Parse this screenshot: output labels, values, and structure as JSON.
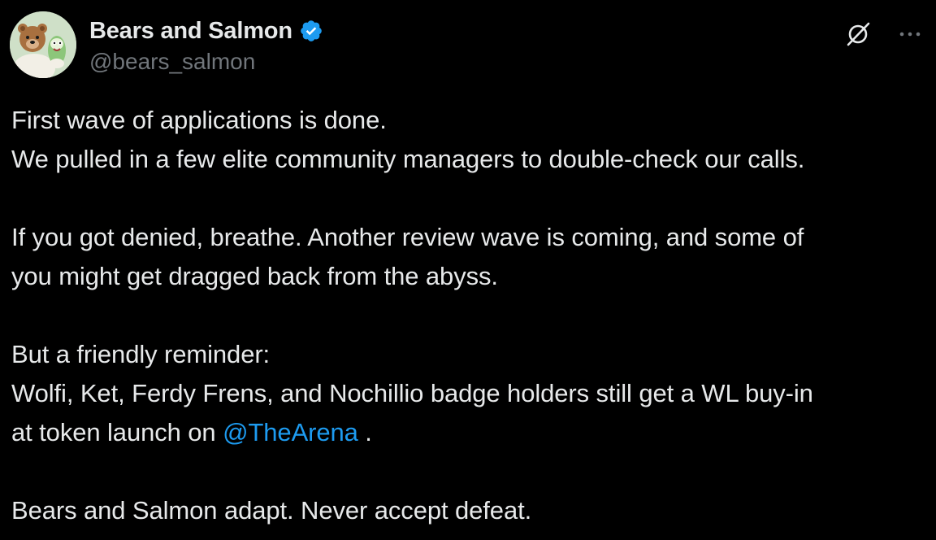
{
  "author": {
    "display_name": "Bears and Salmon",
    "handle": "@bears_salmon",
    "verified": true,
    "avatar_icon": "bear-and-salmon-avatar"
  },
  "actions": {
    "grok_icon": "grok-icon",
    "more_icon": "more-icon"
  },
  "tweet": {
    "p1_l1": "First wave of applications is done.",
    "p1_l2": "We pulled in a few elite community managers to double-check our calls.",
    "p2_l1": "If you got denied, breathe. Another review wave is coming, and some of",
    "p2_l2": "you might get dragged back from the abyss.",
    "p3_l1": "But a friendly reminder:",
    "p3_l2": "Wolfi, Ket, Ferdy Frens, and Nochillio badge holders still get a WL buy-in",
    "p3_l3_prefix": "at token launch on ",
    "p3_l3_mention": "@TheArena",
    "p3_l3_suffix": " .",
    "p4_l1": "Bears and Salmon adapt. Never accept defeat."
  },
  "colors": {
    "background": "#000000",
    "text": "#e7e9ea",
    "secondary": "#71767b",
    "accent": "#1d9bf0"
  }
}
